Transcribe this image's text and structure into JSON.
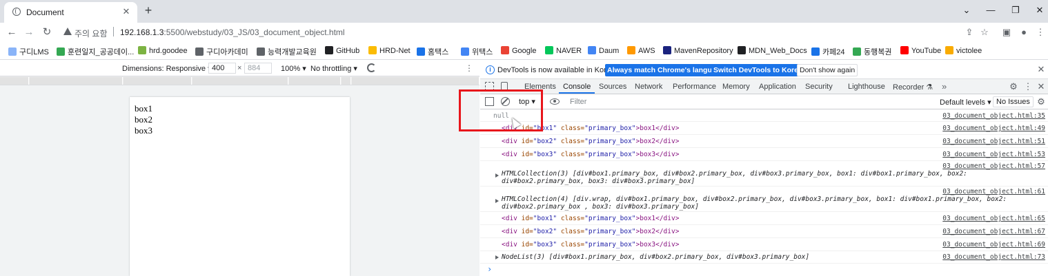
{
  "browser": {
    "tab_title": "Document",
    "tab_close": "✕",
    "new_tab": "+",
    "window_controls": {
      "minimize": "⌄",
      "restore": "—",
      "maximize": "❐",
      "close": "✕"
    },
    "nav": {
      "back": "←",
      "forward": "→",
      "reload": "↻"
    },
    "security_label": "주의 요함",
    "url_host": "192.168.1.3",
    "url_path": ":5500/webstudy/03_JS/03_document_object.html",
    "toolbar_right": {
      "share": "⇪",
      "star": "☆",
      "sidepanel": "▣",
      "profile": "●",
      "menu": "⋮"
    }
  },
  "bookmarks": [
    {
      "label": "구디LMS",
      "color": "#8ab4f8"
    },
    {
      "label": "훈련일지_공공데이...",
      "color": "#34a853"
    },
    {
      "label": "hrd.goodee",
      "color": "#7cb342"
    },
    {
      "label": "구디아카데미",
      "color": "#5f6368"
    },
    {
      "label": "능력개발교육원",
      "color": "#5f6368"
    },
    {
      "label": "GitHub",
      "color": "#202124"
    },
    {
      "label": "HRD-Net",
      "color": "#fbbc04"
    },
    {
      "label": "홈택스",
      "color": "#1a73e8"
    },
    {
      "label": "위택스",
      "color": "#4285f4"
    },
    {
      "label": "Google",
      "color": "#ea4335"
    },
    {
      "label": "NAVER",
      "color": "#03c75a"
    },
    {
      "label": "Daum",
      "color": "#4285f4"
    },
    {
      "label": "AWS",
      "color": "#ff9900"
    },
    {
      "label": "MavenRepository",
      "color": "#1a237e"
    },
    {
      "label": "MDN_Web_Docs",
      "color": "#202124"
    },
    {
      "label": "카페24",
      "color": "#1a73e8"
    },
    {
      "label": "동행복권",
      "color": "#34a853"
    },
    {
      "label": "YouTube",
      "color": "#ff0000"
    },
    {
      "label": "victolee",
      "color": "#f9ab00"
    }
  ],
  "device_toolbar": {
    "dimensions": "Dimensions: Responsive ▾",
    "width": "400",
    "height": "884",
    "x": "×",
    "zoom": "100% ▾",
    "throttling": "No throttling ▾",
    "more": "⋮"
  },
  "page": {
    "boxes": [
      "box1",
      "box2",
      "box3"
    ]
  },
  "devtools": {
    "info_text": "DevTools is now available in Korean!",
    "btn_match": "Always match Chrome's language",
    "btn_switch": "Switch DevTools to Korean",
    "btn_dont_show": "Don't show again",
    "close": "✕",
    "tabs": [
      "Elements",
      "Console",
      "Sources",
      "Network",
      "Performance",
      "Memory",
      "Application",
      "Security",
      "Lighthouse",
      "Recorder ⚗"
    ],
    "tabs_more": "»",
    "settings": "⚙",
    "more": "⋮",
    "context": "top ▾",
    "filter_placeholder": "Filter",
    "levels": "Default levels ▾",
    "issues": "No Issues",
    "console_settings": "⚙",
    "prompt": "›"
  },
  "console": {
    "null_text": "null",
    "src_35": "03_document_object.html:35",
    "src_49": "03_document_object.html:49",
    "src_51": "03_document_object.html:51",
    "src_53": "03_document_object.html:53",
    "src_57": "03_document_object.html:57",
    "src_61": "03_document_object.html:61",
    "src_65": "03_document_object.html:65",
    "src_67": "03_document_object.html:67",
    "src_69": "03_document_object.html:69",
    "src_73": "03_document_object.html:73",
    "div_open": "<div",
    "id_attr": " id=",
    "class_attr": " class=",
    "box1_id": "\"box1\"",
    "box2_id": "\"box2\"",
    "box3_id": "\"box3\"",
    "class_val": "\"primary_box\"",
    "box1_close": ">box1</div>",
    "box2_close": ">box2</div>",
    "box3_close": ">box3</div>",
    "coll3": "HTMLCollection(3) [div#box1.primary_box, div#box2.primary_box, div#box3.primary_box, box1: div#box1.primary_box, box2: div#box2.primary_box, box3: div#box3.primary_box]",
    "coll4": "HTMLCollection(4) [div.wrap, div#box1.primary_box, div#box2.primary_box, div#box3.primary_box, box1: div#box1.primary_box, box2: div#box2.primary_box , box3: div#box3.primary_box]",
    "nodelist": "NodeList(3) [div#box1.primary_box, div#box2.primary_box, div#box3.primary_box]"
  },
  "colors": {
    "highlight": "#e8151b",
    "accent": "#1a73e8"
  }
}
